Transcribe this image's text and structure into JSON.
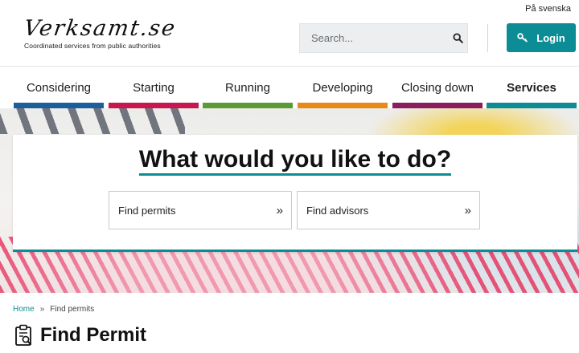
{
  "header": {
    "language_link": "På svenska",
    "logo_text": "Verksamt.se",
    "logo_tagline": "Coordinated services from public authorities",
    "search_placeholder": "Search...",
    "login_label": "Login"
  },
  "nav": {
    "items": [
      {
        "label": "Considering",
        "color": "#1c5e9b"
      },
      {
        "label": "Starting",
        "color": "#c8174f"
      },
      {
        "label": "Running",
        "color": "#5c9a33"
      },
      {
        "label": "Developing",
        "color": "#e88a16"
      },
      {
        "label": "Closing down",
        "color": "#8a1d5e"
      },
      {
        "label": "Services",
        "color": "#0c8d95",
        "active": true
      }
    ]
  },
  "hero": {
    "title": "What would you like to do?",
    "options": [
      {
        "label": "Find permits",
        "icon": "double-chevron-right-icon"
      },
      {
        "label": "Find advisors",
        "icon": "double-chevron-right-icon"
      }
    ]
  },
  "breadcrumb": {
    "home": "Home",
    "separator": "»",
    "current": "Find permits"
  },
  "page": {
    "title": "Find Permit",
    "icon": "clipboard-search-icon"
  },
  "colors": {
    "accent": "#0c8d95"
  }
}
